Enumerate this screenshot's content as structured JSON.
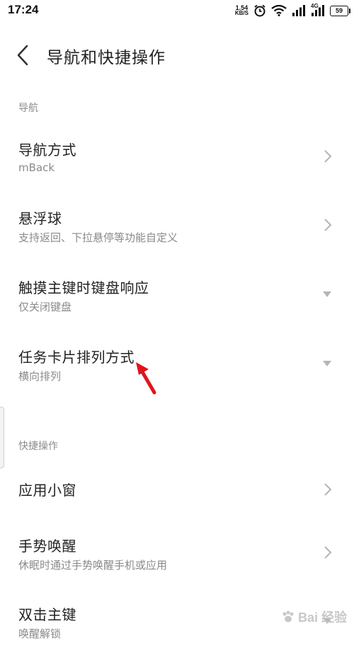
{
  "status": {
    "time": "17:24",
    "speed_value": "1.54",
    "speed_unit": "KB/S",
    "network": "4G",
    "battery": "59"
  },
  "header": {
    "title": "导航和快捷操作"
  },
  "sections": {
    "nav": {
      "label": "导航"
    },
    "shortcuts": {
      "label": "快捷操作"
    }
  },
  "items": [
    {
      "title": "导航方式",
      "subtitle": "mBack",
      "control": "chevron"
    },
    {
      "title": "悬浮球",
      "subtitle": "支持返回、下拉悬停等功能自定义",
      "control": "chevron"
    },
    {
      "title": "触摸主键时键盘响应",
      "subtitle": "仅关闭键盘",
      "control": "dropdown"
    },
    {
      "title": "任务卡片排列方式",
      "subtitle": "横向排列",
      "control": "dropdown"
    },
    {
      "title": "应用小窗",
      "subtitle": "",
      "control": "chevron"
    },
    {
      "title": "手势唤醒",
      "subtitle": "休眠时通过手势唤醒手机或应用",
      "control": "chevron"
    },
    {
      "title": "双击主键",
      "subtitle": "唤醒解锁",
      "control": "dropdown"
    }
  ],
  "watermark": {
    "text": "Bai 经验"
  },
  "colors": {
    "annotation_arrow": "#e0141e",
    "secondary_text": "#8a8a8a",
    "chevron": "#b5b5b5"
  }
}
